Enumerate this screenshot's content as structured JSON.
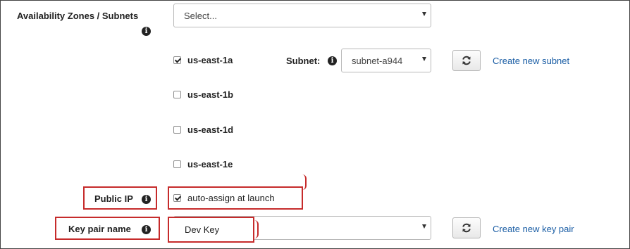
{
  "availability": {
    "label": "Availability Zones / Subnets",
    "select_value": "Select...",
    "zones": [
      {
        "name": "us-east-1a",
        "checked": true
      },
      {
        "name": "us-east-1b",
        "checked": false
      },
      {
        "name": "us-east-1d",
        "checked": false
      },
      {
        "name": "us-east-1e",
        "checked": false
      }
    ],
    "subnet_label": "Subnet:",
    "subnet_value": "subnet-a944",
    "create_subnet_link": "Create new subnet"
  },
  "public_ip": {
    "label": "Public IP",
    "checkbox_label": "auto-assign at launch",
    "checked": true
  },
  "key_pair": {
    "label": "Key pair name",
    "select_value": "Dev Key",
    "create_link": "Create new key pair"
  },
  "icons": [
    "info-icon",
    "refresh-icon",
    "checkbox-checked-icon",
    "chevron-down-icon"
  ],
  "colors": {
    "link": "#1b5ea5",
    "highlight": "#c62b2b"
  }
}
